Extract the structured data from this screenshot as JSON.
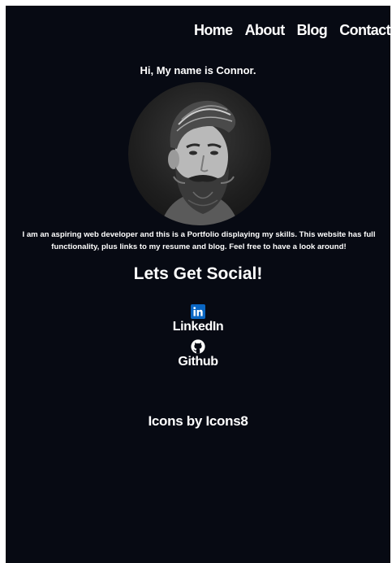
{
  "nav": {
    "items": [
      "Home",
      "About",
      "Blog",
      "Contact"
    ]
  },
  "intro": {
    "greeting": "Hi, My name is Connor."
  },
  "bio": {
    "text": "I am an aspiring web developer and this is a Portfolio displaying my skills. This website has full functionality, plus links to my resume and blog. Feel free to have a look around!"
  },
  "social": {
    "heading": "Lets Get Social!",
    "links": [
      {
        "label": "LinkedIn",
        "icon": "linkedin-icon",
        "color": "#0a66c2"
      },
      {
        "label": "Github",
        "icon": "github-icon",
        "color": "#ffffff"
      }
    ]
  },
  "credits": {
    "text": "Icons by Icons8"
  },
  "colors": {
    "background": "#070a13",
    "text": "#ffffff",
    "linkedin": "#0a66c2"
  }
}
